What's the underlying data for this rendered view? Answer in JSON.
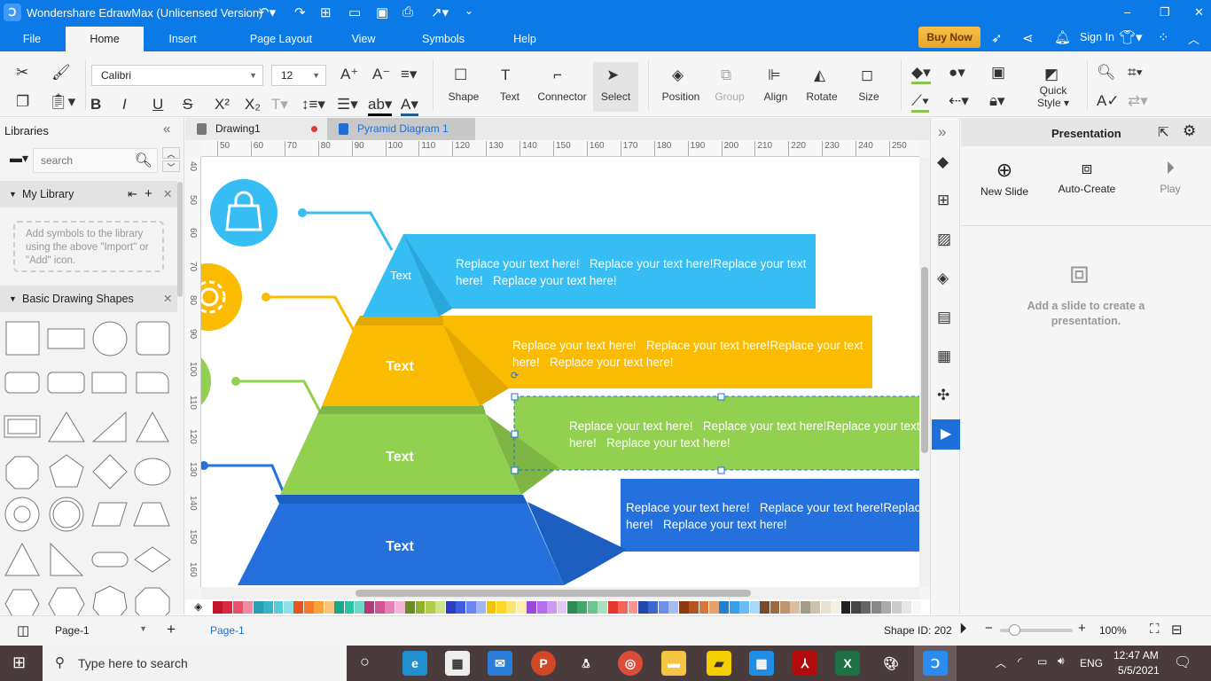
{
  "app": {
    "title": "Wondershare EdrawMax (Unlicensed Version)"
  },
  "window": {
    "minimize": "–",
    "restore": "❐",
    "close": "✕"
  },
  "menu": {
    "items": [
      "File",
      "Home",
      "Insert",
      "Page Layout",
      "View",
      "Symbols",
      "Help"
    ],
    "active": "Home",
    "buy_now": "Buy Now",
    "sign_in": "Sign In"
  },
  "ribbon": {
    "font": "Calibri",
    "size": "12",
    "shape": "Shape",
    "text": "Text",
    "connector": "Connector",
    "select": "Select",
    "position": "Position",
    "group": "Group",
    "align": "Align",
    "rotate": "Rotate",
    "size_label": "Size",
    "quick_style_1": "Quick",
    "quick_style_2": "Style"
  },
  "left": {
    "title": "Libraries",
    "search_placeholder": "search",
    "my_library": "My Library",
    "empty_hint": "Add symbols to the library using the above \"Import\" or \"Add\" icon.",
    "basic_shapes": "Basic Drawing Shapes"
  },
  "tabs": [
    {
      "label": "Drawing1",
      "unsaved": true
    },
    {
      "label": "Pyramid Diagram 1",
      "active": true
    }
  ],
  "rulers": {
    "top": [
      50,
      60,
      70,
      80,
      90,
      100,
      110,
      120,
      130,
      140,
      150,
      160,
      170,
      180,
      190,
      200,
      210,
      220,
      230,
      240,
      250
    ],
    "left": [
      40,
      50,
      60,
      70,
      80,
      90,
      100,
      110,
      120,
      130,
      140,
      150,
      160
    ]
  },
  "diagram": {
    "levels": [
      {
        "label": "Text",
        "description": "Replace your text here!   Replace your text here!Replace your text here!   Replace your text here!",
        "color": "#35bdf4"
      },
      {
        "label": "Text",
        "description": "Replace your text here!   Replace your text here!Replace your text here!   Replace your text here!",
        "color": "#fbbb00"
      },
      {
        "label": "Text",
        "description": "Replace your text here!   Replace your text here!Replace your text here!   Replace your text here!",
        "color": "#92d050"
      },
      {
        "label": "Text",
        "description": "Replace your text here!   Replace your text here!Replace your text here!   Replace your text here!",
        "color": "#2470dd"
      }
    ],
    "icons": [
      "shopping-bag-icon",
      "gear-icon"
    ]
  },
  "palette": [
    "#c0152a",
    "#d9283f",
    "#e9506a",
    "#f08aa0",
    "#2a9fb0",
    "#35b6c8",
    "#56cad8",
    "#8fe0ea",
    "#e8541e",
    "#f47b2a",
    "#f9a13b",
    "#fbc37a",
    "#17a88e",
    "#2bc2a4",
    "#6fd8c2",
    "#b53a7a",
    "#d05596",
    "#e680b5",
    "#f3b6d6",
    "#6a8e1e",
    "#8fb02d",
    "#b0cc4a",
    "#cfe38a",
    "#2b3fbf",
    "#3d5ee0",
    "#6c86f0",
    "#a3b4f7",
    "#f2c500",
    "#fbd82b",
    "#fde66f",
    "#fff0a8",
    "#9a4ad6",
    "#b46ee8",
    "#cc9af2",
    "#e4c7f9",
    "#2e8b57",
    "#3fa86a",
    "#6cc58e",
    "#a8e0bd",
    "#e8362e",
    "#f0645c",
    "#f59690",
    "#2348a8",
    "#3a68d0",
    "#6b90e6",
    "#a5bdf2",
    "#8b3a0e",
    "#b5541e",
    "#d5773a",
    "#e8a06c",
    "#1f7fd0",
    "#37a0ec",
    "#6cbcf3",
    "#a9d8f9",
    "#7a4a2a",
    "#9a6a44",
    "#bf9470",
    "#d9bea2",
    "#a39c88",
    "#c8c2ae",
    "#e6e1d2",
    "#f4f0e4",
    "#222222",
    "#444444",
    "#666666",
    "#888888",
    "#aaaaaa",
    "#cccccc",
    "#e6e6e6",
    "#f7f7f7"
  ],
  "right": {
    "title": "Presentation",
    "new_slide": "New Slide",
    "auto_create": "Auto-Create",
    "play": "Play",
    "empty": "Add a slide to create a presentation."
  },
  "status": {
    "page_select": "Page-1",
    "page_tab": "Page-1",
    "shape_id": "Shape ID: 202",
    "zoom": "100%",
    "zoom_level": 0.2
  },
  "taskbar": {
    "search_placeholder": "Type here to search",
    "lang": "ENG",
    "time": "12:47 AM",
    "date": "5/5/2021"
  }
}
